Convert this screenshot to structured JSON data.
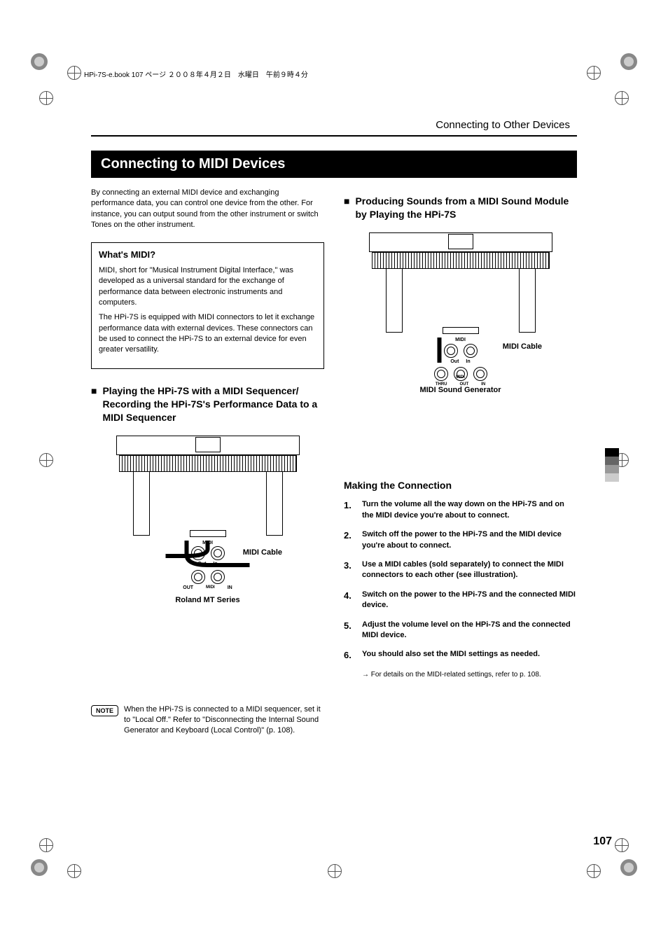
{
  "cropmark_text": "HPi-7S-e.book  107 ページ  ２００８年４月２日　水曜日　午前９時４分",
  "header_section": "Connecting to Other Devices",
  "section_title": "Connecting to MIDI Devices",
  "intro": "By connecting an external MIDI device and exchanging performance data, you can control one device from the other. For instance, you can output sound from the other instrument or switch Tones on the other instrument.",
  "whats_midi": {
    "title": "What's MIDI?",
    "p1": "MIDI, short for \"Musical Instrument Digital Interface,\" was developed as a universal standard for the exchange of performance data between electronic instruments and computers.",
    "p2": "The HPi-7S is equipped with MIDI connectors to let it exchange performance data with external devices. These connectors can be used to connect the HPi-7S to an external device for even greater versatility."
  },
  "left_subheading": "Playing the HPi-7S with a MIDI Sequencer/ Recording the HPi-7S's Performance Data to a MIDI Sequencer",
  "diagram_left": {
    "midi_label": "MIDI",
    "out": "Out",
    "in": "In",
    "cable": "MIDI Cable",
    "dev_out": "OUT",
    "dev_mid": "MIDI",
    "dev_in": "IN",
    "caption": "Roland MT Series"
  },
  "note_badge": "NOTE",
  "note_text": "When the HPi-7S is connected to a MIDI sequencer, set it to \"Local Off.\" Refer to \"Disconnecting the Internal Sound Generator and Keyboard (Local Control)\" (p. 108).",
  "right_subheading": "Producing Sounds from a MIDI Sound Module by Playing the HPi-7S",
  "diagram_right": {
    "midi_label": "MIDI",
    "out": "Out",
    "in": "In",
    "cable": "MIDI Cable",
    "thru": "THRU",
    "dev_out": "OUT",
    "dev_in": "IN",
    "dev_mid": "MIDI",
    "caption": "MIDI Sound Generator"
  },
  "making_connection": "Making the Connection",
  "steps": [
    "Turn the volume all the way down on the HPi-7S and on the MIDI device you're about to connect.",
    "Switch off the power to the HPi-7S and the MIDI device you're about to connect.",
    "Use a MIDI cables (sold separately) to connect the MIDI connectors to each other (see illustration).",
    "Switch on the power to the HPi-7S and the connected MIDI device.",
    "Adjust the volume level on the HPi-7S and the connected MIDI device.",
    "You should also set the MIDI settings as needed."
  ],
  "step_subnote": "→ For details on the MIDI-related settings, refer to p. 108.",
  "page_number": "107"
}
